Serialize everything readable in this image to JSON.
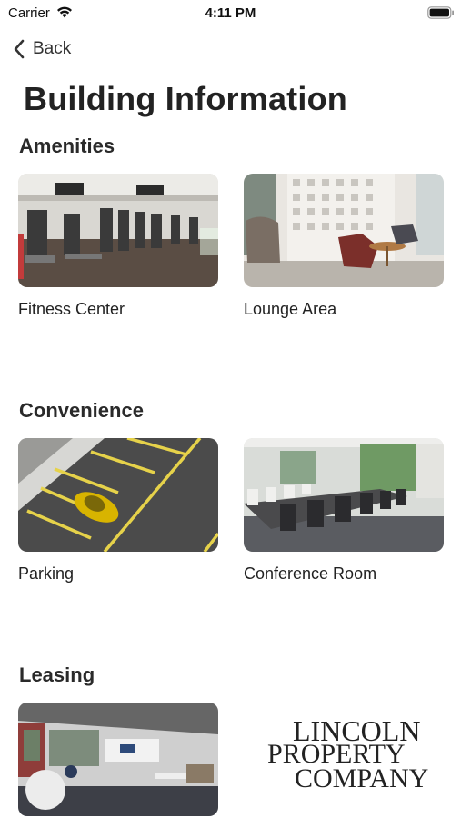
{
  "status_bar": {
    "carrier": "Carrier",
    "time": "4:11 PM"
  },
  "nav": {
    "back_label": "Back"
  },
  "page": {
    "title": "Building Information"
  },
  "sections": [
    {
      "title": "Amenities",
      "cards": [
        {
          "label": "Fitness Center"
        },
        {
          "label": "Lounge Area"
        }
      ]
    },
    {
      "title": "Convenience",
      "cards": [
        {
          "label": "Parking"
        },
        {
          "label": "Conference Room"
        }
      ]
    },
    {
      "title": "Leasing",
      "cards": [
        {
          "label": ""
        }
      ]
    }
  ],
  "logo": {
    "line1": "LINCOLN",
    "line2": "PROPERTY",
    "line3": "COMPANY"
  }
}
